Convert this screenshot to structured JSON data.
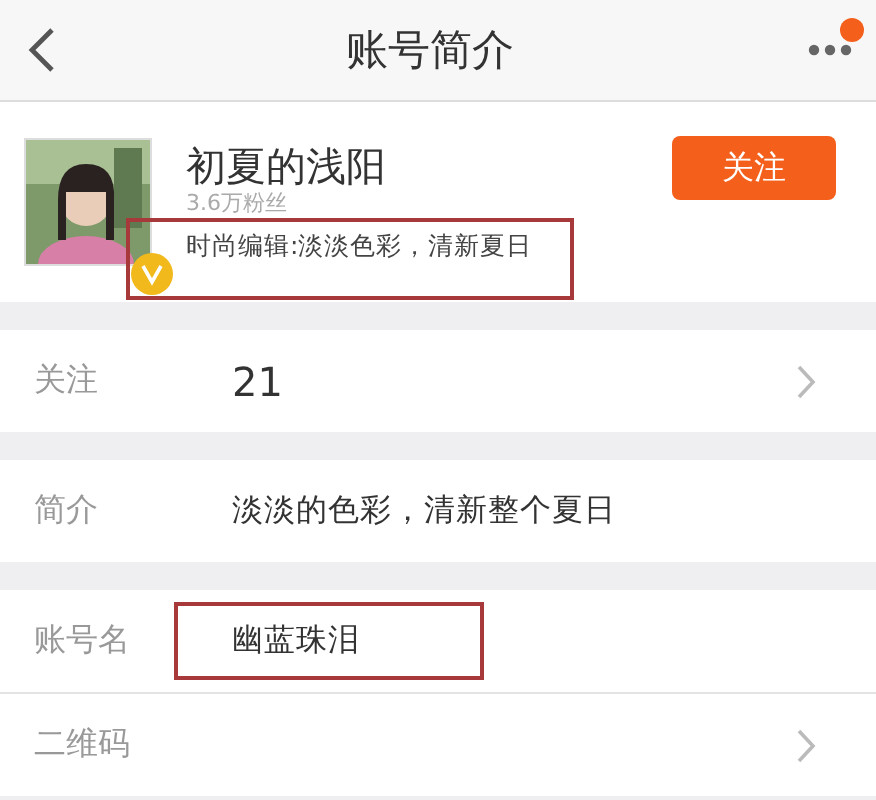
{
  "nav": {
    "title": "账号简介",
    "more_badge": true
  },
  "profile": {
    "name": "初夏的浅阳",
    "followers": "3.6万粉丝",
    "bio": "时尚编辑:淡淡色彩，清新夏日",
    "bio_highlighted": true,
    "verified": true,
    "follow_button": "关注"
  },
  "sections": [
    [
      {
        "kind": "count",
        "label": "关注",
        "value": "21",
        "chevron": true,
        "highlighted": false
      }
    ],
    [
      {
        "kind": "text",
        "label": "简介",
        "value": "淡淡的色彩，清新整个夏日",
        "chevron": false,
        "highlighted": false
      }
    ],
    [
      {
        "kind": "text",
        "label": "账号名",
        "value": "幽蓝珠泪",
        "chevron": false,
        "highlighted": true
      },
      {
        "kind": "text",
        "label": "二维码",
        "chevron": true,
        "highlighted": false
      }
    ]
  ]
}
